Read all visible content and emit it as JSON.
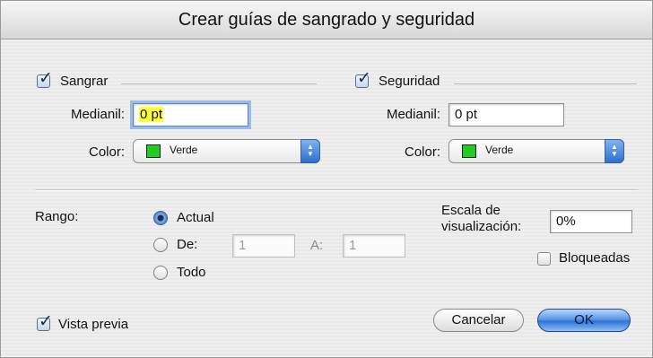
{
  "window": {
    "title": "Crear guías de sangrado y seguridad"
  },
  "bleed": {
    "checkbox_label": "Sangrar",
    "checked": true,
    "gutter_label": "Medianil:",
    "gutter_value": "0 pt",
    "color_label": "Color:",
    "color_value": "Verde",
    "color_hex": "#22cc22"
  },
  "safety": {
    "checkbox_label": "Seguridad",
    "checked": true,
    "gutter_label": "Medianil:",
    "gutter_value": "0 pt",
    "color_label": "Color:",
    "color_value": "Verde",
    "color_hex": "#22cc22"
  },
  "range": {
    "label": "Rango:",
    "options": [
      {
        "label": "Actual",
        "selected": true
      },
      {
        "label": "De:",
        "selected": false
      },
      {
        "label": "Todo",
        "selected": false
      }
    ],
    "from_value": "1",
    "to_label": "A:",
    "to_value": "1"
  },
  "view_scale": {
    "label_line1": "Escala de",
    "label_line2": "visualización:",
    "value": "0%"
  },
  "locked": {
    "label": "Bloqueadas",
    "checked": false
  },
  "preview": {
    "label": "Vista previa",
    "checked": true
  },
  "buttons": {
    "cancel": "Cancelar",
    "ok": "OK"
  },
  "colors": {
    "accent": "#3f78cf",
    "swatch_green": "#22cc22",
    "highlight": "#ffff3a"
  }
}
